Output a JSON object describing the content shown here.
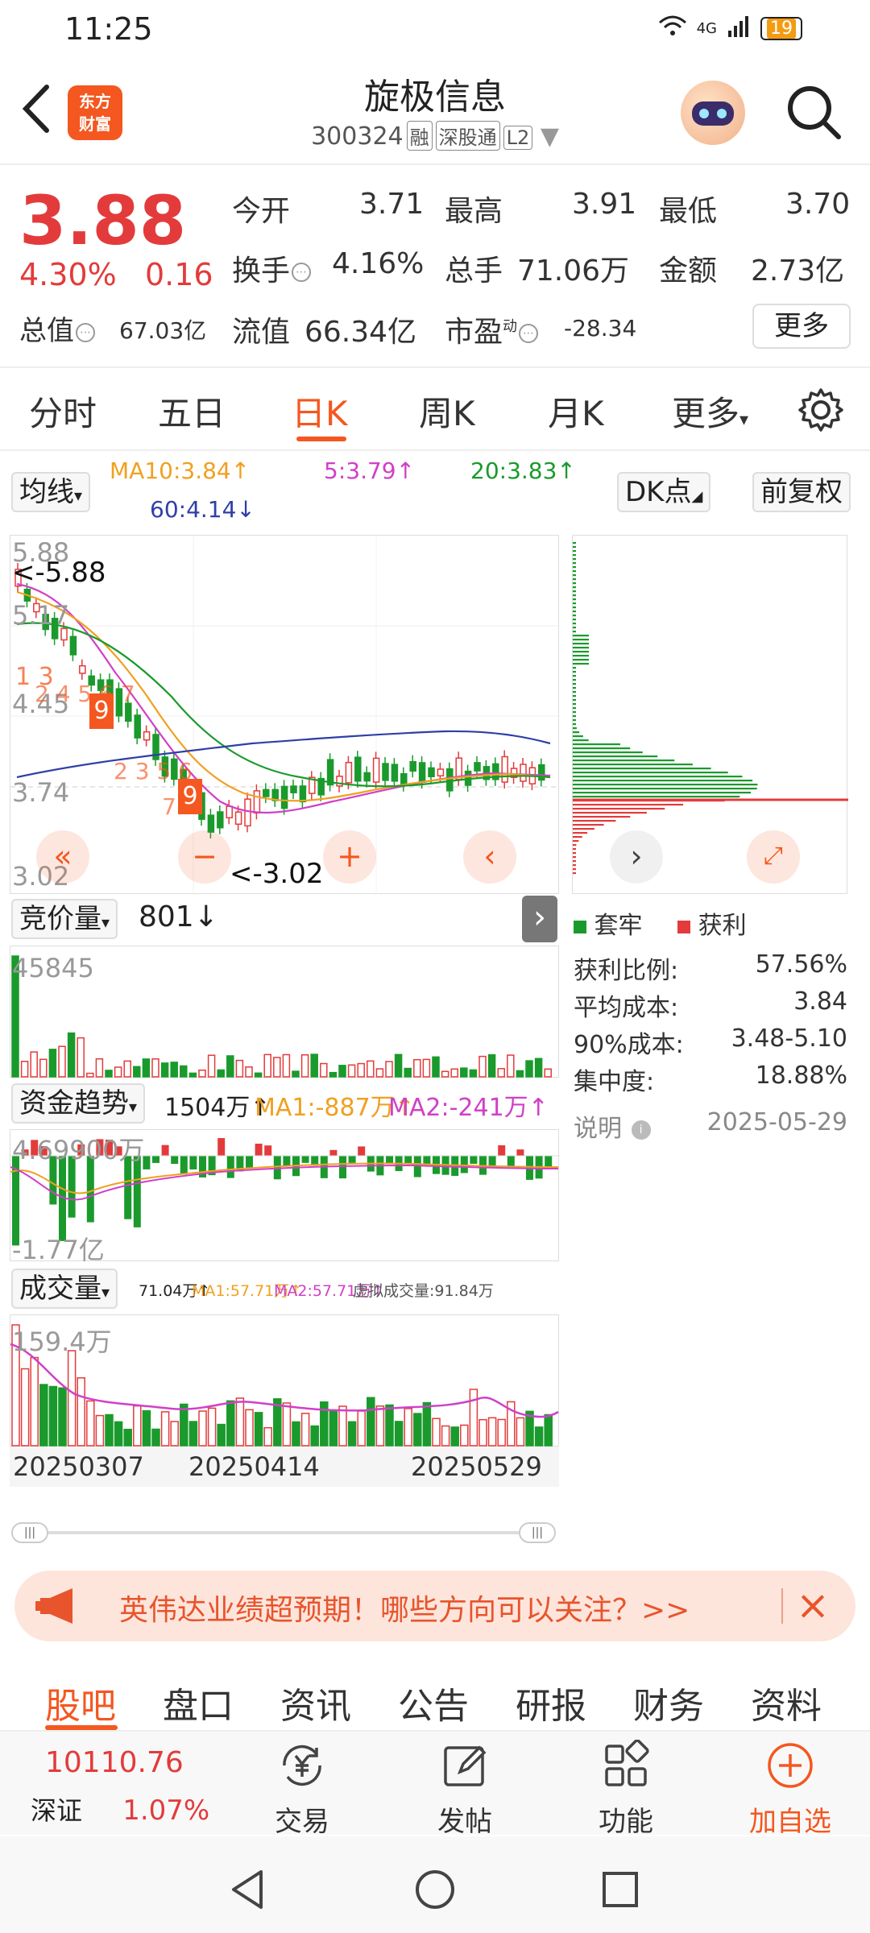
{
  "status": {
    "time": "11:25",
    "network": "4G",
    "battery": "19"
  },
  "header": {
    "name": "旋极信息",
    "code": "300324",
    "tags": [
      "融",
      "深股通",
      "L2"
    ],
    "logo_line1": "东方",
    "logo_line2": "财富"
  },
  "quote": {
    "price": "3.88",
    "pct": "4.30%",
    "change": "0.16",
    "open_label": "今开",
    "open": "3.71",
    "high_label": "最高",
    "high": "3.91",
    "low_label": "最低",
    "low": "3.70",
    "turnover_label": "换手",
    "turnover": "4.16%",
    "volume_label": "总手",
    "volume": "71.06万",
    "amount_label": "金额",
    "amount": "2.73亿",
    "mcap_label": "总值",
    "mcap": "67.03亿",
    "float_label": "流值",
    "float": "66.34亿",
    "pe_label": "市盈",
    "pe_sup": "动",
    "pe": "-28.34",
    "more": "更多"
  },
  "tabs": [
    "分时",
    "五日",
    "日K",
    "周K",
    "月K",
    "更多"
  ],
  "chart": {
    "ma_label": "均线",
    "ma10": "MA10:3.84↑",
    "ma5": "5:3.79↑",
    "ma20": "20:3.83↑",
    "ma60": "60:4.14↓",
    "dk_label": "DK点",
    "fq_label": "前复权",
    "y_top": "5.88",
    "y_mid1": "5.17",
    "y_mid2": "4.45",
    "y_mid3": "3.74",
    "y_bot": "3.02",
    "max_mark": "<-5.88",
    "min_mark": "<-3.02",
    "seq1": "1 3",
    "seq2": "2 4 5 6 7",
    "seq3": "9",
    "seq4": "2 3 5 6",
    "seq5": "7",
    "seq6": "9"
  },
  "chip": {
    "legend_trap": "套牢",
    "legend_profit": "获利"
  },
  "chip_stats": {
    "profit_ratio_label": "获利比例:",
    "profit_ratio": "57.56%",
    "avg_cost_label": "平均成本:",
    "avg_cost": "3.84",
    "cost90_label": "90%成本:",
    "cost90": "3.48-5.10",
    "concentration_label": "集中度:",
    "concentration": "18.88%",
    "note_label": "说明",
    "date": "2025-05-29"
  },
  "auction": {
    "label": "竞价量",
    "value": "801↓",
    "max": "45845"
  },
  "fund": {
    "label": "资金趋势",
    "value": "1504万↑",
    "ma1": "MA1:-887万↑",
    "ma2": "MA2:-241万↑",
    "top": "4.69900万",
    "bottom": "-1.77亿"
  },
  "vol": {
    "label": "成交量",
    "value": "71.04万↑",
    "ma1": "MA1:57.71万↑",
    "ma2": "MA2:57.71万↑",
    "virtual": "虚拟成交量:91.84万",
    "max": "159.4万"
  },
  "dates": [
    "20250307",
    "20250414",
    "20250529"
  ],
  "banner": {
    "text": "英伟达业绩超预期！哪些方向可以关注？>>"
  },
  "bottom_tabs": [
    "股吧",
    "盘口",
    "资讯",
    "公告",
    "研报",
    "财务",
    "资料"
  ],
  "footer": {
    "index_value": "10110.76",
    "index_name": "深证",
    "index_pct": "1.07%",
    "trade": "交易",
    "post": "发帖",
    "func": "功能",
    "add": "加自选"
  },
  "colors": {
    "up": "#e33b3b",
    "down": "#1a9a2c",
    "accent": "#f4571f",
    "ma5": "#d040c8",
    "ma10": "#f0a020",
    "ma20": "#1a9a2c",
    "ma60": "#2f3fa8"
  }
}
